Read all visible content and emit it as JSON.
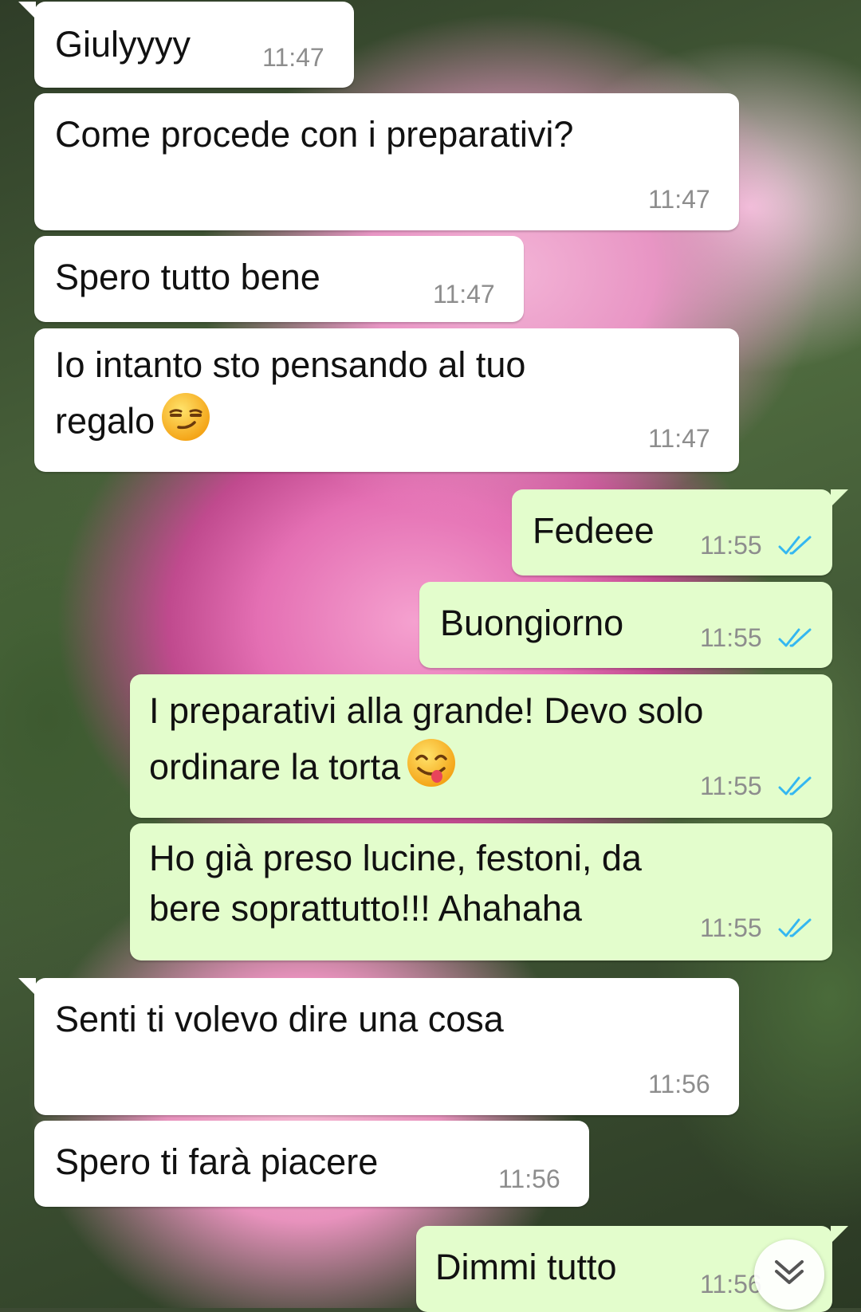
{
  "messages": [
    {
      "text": "Giulyyyy",
      "time": "11:47"
    },
    {
      "text": "Come procede con i preparativi?",
      "time": "11:47"
    },
    {
      "text": "Spero tutto bene",
      "time": "11:47"
    },
    {
      "text_line1": "Io intanto sto pensando al tuo",
      "text_line2": "regalo",
      "emoji": "smirking-face",
      "time": "11:47"
    },
    {
      "text": "Fedeee",
      "time": "11:55"
    },
    {
      "text": "Buongiorno",
      "time": "11:55"
    },
    {
      "text_line1": "I preparativi alla grande! Devo solo",
      "text_line2": "ordinare la torta",
      "emoji": "face-savoring-food",
      "time": "11:55"
    },
    {
      "text_line1": "Ho già preso lucine, festoni, da",
      "text_line2": "bere soprattutto!!! Ahahaha",
      "time": "11:55"
    },
    {
      "text": "Senti ti volevo dire una cosa",
      "time": "11:56"
    },
    {
      "text": "Spero ti farà piacere",
      "time": "11:56"
    },
    {
      "text": "Dimmi tutto",
      "time": "11:56"
    }
  ],
  "colors": {
    "incoming_bubble": "#ffffff",
    "outgoing_bubble": "#e3fdcc",
    "read_ticks": "#34b7f1",
    "timestamp": "#8d8d8d"
  },
  "icons": {
    "read_receipt": "double-check-icon",
    "scroll_down": "double-chevron-down-icon"
  }
}
